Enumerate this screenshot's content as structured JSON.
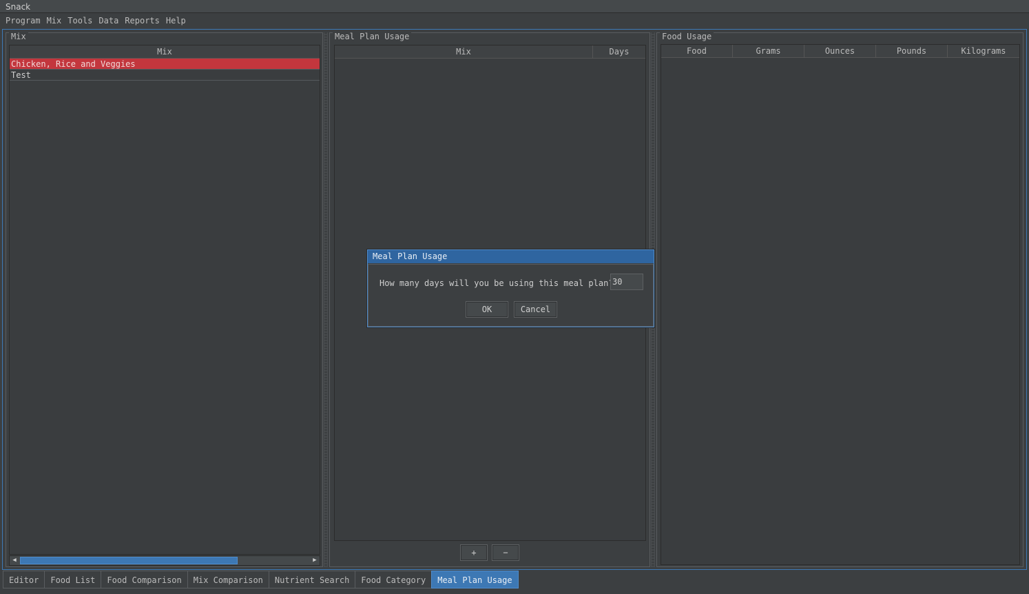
{
  "window": {
    "title": "Snack"
  },
  "menu": [
    "Program",
    "Mix",
    "Tools",
    "Data",
    "Reports",
    "Help"
  ],
  "mix_panel": {
    "title": "Mix",
    "column": "Mix",
    "rows": [
      "Chicken, Rice and Veggies",
      "Test"
    ],
    "selected_index": 0
  },
  "meal_plan_panel": {
    "title": "Meal Plan Usage",
    "columns": [
      "Mix",
      "Days"
    ],
    "add_label": "+",
    "remove_label": "−"
  },
  "food_usage_panel": {
    "title": "Food Usage",
    "columns": [
      "Food",
      "Grams",
      "Ounces",
      "Pounds",
      "Kilograms"
    ]
  },
  "tabs": [
    "Editor",
    "Food List",
    "Food Comparison",
    "Mix Comparison",
    "Nutrient Search",
    "Food Category",
    "Meal Plan Usage"
  ],
  "active_tab": "Meal Plan Usage",
  "dialog": {
    "title": "Meal Plan Usage",
    "prompt": "How many days will you be using this meal plan?",
    "value": "30",
    "ok_label": "OK",
    "cancel_label": "Cancel"
  },
  "colors": {
    "background": "#3c3f41",
    "accent": "#3d78b4",
    "selection": "#c3363d"
  }
}
